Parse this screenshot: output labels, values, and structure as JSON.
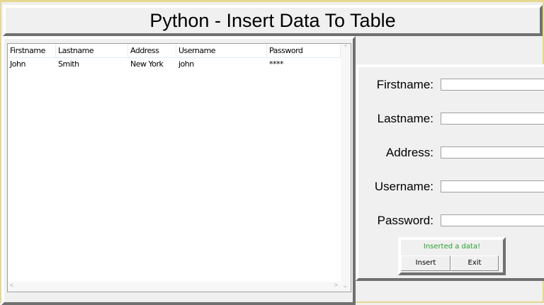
{
  "title": "Python - Insert Data To Table",
  "table": {
    "columns": [
      "Firstname",
      "Lastname",
      "Address",
      "Username",
      "Password"
    ],
    "rows": [
      [
        "John",
        "Smith",
        "New York",
        "john",
        "****"
      ]
    ]
  },
  "form": {
    "labels": [
      "Firstname:",
      "Lastname:",
      "Address:",
      "Username:",
      "Password:"
    ],
    "status": "Inserted a data!",
    "insert": "Insert",
    "exit": "Exit"
  },
  "colors": {
    "status": "#28a030"
  }
}
